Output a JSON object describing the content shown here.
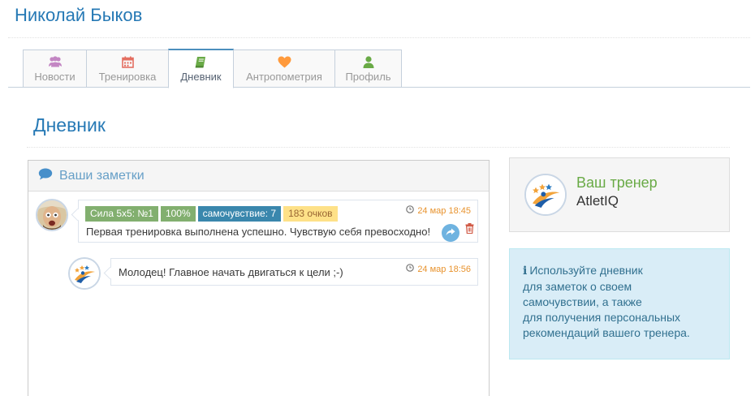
{
  "header": {
    "user_name": "Николай Быков"
  },
  "tabs": [
    {
      "label": "Новости",
      "icon": "users-icon",
      "color": "#c386c3"
    },
    {
      "label": "Тренировка",
      "icon": "calendar-icon",
      "color": "#e46f61"
    },
    {
      "label": "Дневник",
      "icon": "book-icon",
      "color": "#69aa46",
      "active": true
    },
    {
      "label": "Антропометрия",
      "icon": "heart-icon",
      "color": "#ff9a3c"
    },
    {
      "label": "Профиль",
      "icon": "user-icon",
      "color": "#69aa46"
    }
  ],
  "page": {
    "title": "Дневник"
  },
  "notes": {
    "title": "Ваши заметки",
    "entries": [
      {
        "badges": [
          {
            "text": "Сила 5х5: №1",
            "color": "#82af6f"
          },
          {
            "text": "100%",
            "color": "#82af6f"
          },
          {
            "text": "самочувствие: 7",
            "color": "#3a87ad"
          },
          {
            "text": "183 очков",
            "color": "#fee188"
          }
        ],
        "time": "24 мар 18:45",
        "text": "Первая тренировка выполнена успешно. Чувствую себя превосходно!"
      },
      {
        "time": "24 мар 18:56",
        "text": "Молодец! Главное начать двигаться к цели ;-)"
      }
    ]
  },
  "trainer": {
    "label": "Ваш тренер",
    "name": "AtletIQ"
  },
  "info": {
    "icon": "info-icon",
    "lines": [
      "Используйте дневник",
      "для заметок о своем",
      "самочувствии, а также",
      "для получения персональных",
      "рекомендаций вашего тренера."
    ]
  }
}
